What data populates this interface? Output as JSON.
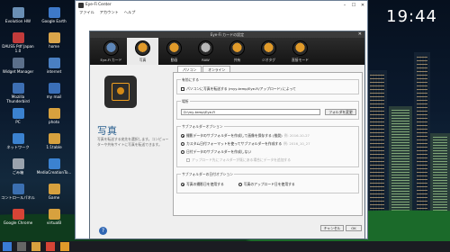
{
  "clock": "19:44",
  "desktop_icons": [
    {
      "label": "Evolution HW",
      "color": "#6a8fb5"
    },
    {
      "label": "Google Earth",
      "color": "#3e79c9"
    },
    {
      "label": "DAUSS Pdf Japan 1.0",
      "color": "#c23b3b"
    },
    {
      "label": "home",
      "color": "#dba54a"
    },
    {
      "label": "Widget Manager",
      "color": "#5b6f8a"
    },
    {
      "label": "internet",
      "color": "#4a7fc2"
    },
    {
      "label": "Mozilla Thunderbird",
      "color": "#3d6fb3"
    },
    {
      "label": "my mail",
      "color": "#3a6fb8"
    },
    {
      "label": "PC",
      "color": "#3b82d0"
    },
    {
      "label": "photo",
      "color": "#d7a13e"
    },
    {
      "label": "ネットワーク",
      "color": "#3b82d0"
    },
    {
      "label": "1:1table",
      "color": "#d7a13e"
    },
    {
      "label": "ごみ箱",
      "color": "#9aa3ad"
    },
    {
      "label": "MediaCreationTo...",
      "color": "#3b82d0"
    },
    {
      "label": "コントロールパネル",
      "color": "#3b6fb0"
    },
    {
      "label": "Game",
      "color": "#d7a13e"
    },
    {
      "label": "Google Chrome",
      "color": "#d64436"
    },
    {
      "label": "virtualB",
      "color": "#d7a13e"
    }
  ],
  "window": {
    "title": "Eye-Fi Center",
    "menu": [
      "ファイル",
      "アカウント",
      "ヘルプ"
    ]
  },
  "dialog": {
    "title": "Eye-Fi カードの設定",
    "close": "✕",
    "toolbar": [
      {
        "label": "Eye-Fi カード",
        "color": "#5d86b8"
      },
      {
        "label": "写真",
        "color": "#e09a2a"
      },
      {
        "label": "動画",
        "color": "#e09a2a"
      },
      {
        "label": "RAW",
        "color": "#b6b6b6"
      },
      {
        "label": "共有",
        "color": "#e09a2a"
      },
      {
        "label": "ジオタグ",
        "color": "#e09a2a"
      },
      {
        "label": "直接モード",
        "color": "#e09a2a"
      }
    ],
    "active_toolbar_index": 1,
    "heading": "写真",
    "description": "写真を転送する宛先を選択します。コンピューターや共有サイトに写真を転送できます。",
    "tabs": [
      "パソコン",
      "オンライン"
    ],
    "active_tab": 0,
    "enable_group": {
      "label": "有効にする",
      "checkbox_label": "パソコンに写真を転送する (myy-temp/Eye-Fi/アップロード) によって"
    },
    "location_group": {
      "label": "場所",
      "path": "D:\\my-temp\\Eye-Fi",
      "browse_button": "フォルダを変更"
    },
    "subfolder_group": {
      "label": "サブフォルダーオプション",
      "options": [
        {
          "label": "撮影データのサブフォルダーを作成して画像を保存する (推奨)",
          "example": "例: 2016-10-27",
          "selected": true
        },
        {
          "label": "カスタム日付フォーマットを使ってサブフォルダーを作成する",
          "example": "例: 2016_10_27",
          "selected": false
        },
        {
          "label": "日付データのサブフォルダーを作成しない",
          "example": "",
          "selected": false
        }
      ],
      "disabled_checkbox_label": "アップロード先にフォルダーが既にある場合にデータを追加する"
    },
    "original_group": {
      "label": "サブフォルダーの日付オプション",
      "options": [
        {
          "label": "写真の撮影日を使用する",
          "selected": true
        },
        {
          "label": "写真のアップロード日を使用する",
          "selected": false
        }
      ]
    },
    "cancel_button": "キャンセル",
    "ok_button": "OK",
    "help_label": "?"
  }
}
